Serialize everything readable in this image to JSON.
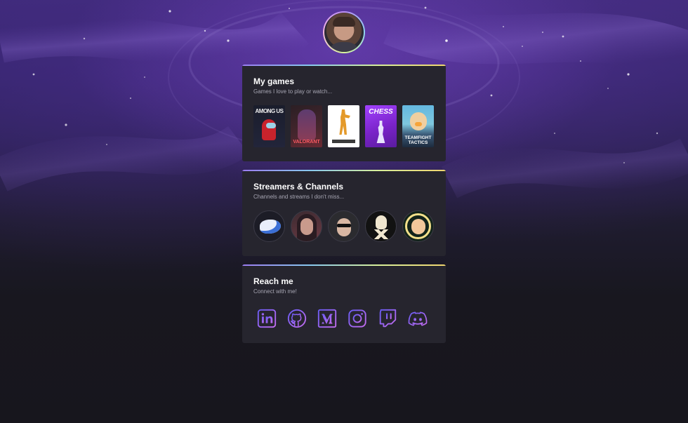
{
  "profile": {
    "avatar_alt": "profile-avatar"
  },
  "games_card": {
    "title": "My games",
    "subtitle": "Games I love to play or watch...",
    "games": [
      {
        "name": "among-us",
        "cover_text": "AMONG US"
      },
      {
        "name": "valorant",
        "cover_text": "VALORANT"
      },
      {
        "name": "counter-strike",
        "cover_text": ""
      },
      {
        "name": "chess",
        "cover_text": "CHESS"
      },
      {
        "name": "teamfight-tactics",
        "cover_text": "TEAMFIGHT TACTICS"
      }
    ]
  },
  "streamers_card": {
    "title": "Streamers & Channels",
    "subtitle": "Channels and streams I don't miss...",
    "channels": [
      {
        "name": "channel-1"
      },
      {
        "name": "channel-2"
      },
      {
        "name": "channel-3"
      },
      {
        "name": "channel-4"
      },
      {
        "name": "channel-5"
      }
    ]
  },
  "reach_card": {
    "title": "Reach me",
    "subtitle": "Connect with me!",
    "links": [
      {
        "icon": "linkedin-icon"
      },
      {
        "icon": "github-icon"
      },
      {
        "icon": "medium-icon"
      },
      {
        "icon": "instagram-icon"
      },
      {
        "icon": "twitch-icon"
      },
      {
        "icon": "discord-icon"
      }
    ]
  },
  "colors": {
    "card_bg": "#26252e",
    "accent_gradient": [
      "#9b7cf1",
      "#88c9ef",
      "#d8ef9a",
      "#f0d56f"
    ],
    "page_bg": "#17161f"
  }
}
